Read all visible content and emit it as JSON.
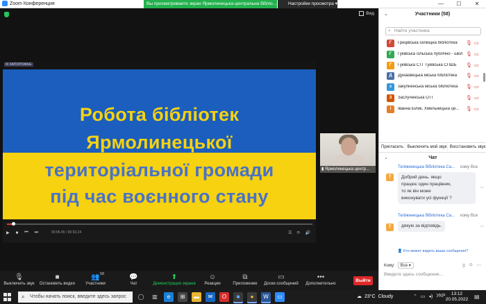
{
  "window": {
    "title": "Zoom Конференция",
    "minimize": "—",
    "maximize": "☐",
    "close": "✕"
  },
  "banner": {
    "text": "Вы просматриваете экран Ярмолинецька центральна бібліо...",
    "view_options": "Настройки просмотра"
  },
  "meeting": {
    "view_label": "Вид",
    "slide": {
      "top_strip": "III ЗАПОРОЖЬЕ",
      "lines": [
        "Робота бібліотек",
        "Ярмолинецької",
        "територіальної громади",
        "під час воєнного стану"
      ],
      "colors": {
        "blue": "#1b5ebe",
        "yellow": "#f6d210"
      }
    },
    "player": {
      "progress": 0.02,
      "time": "00:06.45 / 00:53.24"
    },
    "thumbnail_name": "Ярмолинецька центр..."
  },
  "toolbar": {
    "mute": "Выключить звук",
    "video": "Остановить видео",
    "participants": "Участники",
    "participants_count": "58",
    "chat": "Чат",
    "share": "Демонстрация экрана",
    "reactions": "Реакции",
    "apps": "Приложение",
    "whiteboard": "Доски сообщений",
    "more": "Дополнительно",
    "leave": "Выйти"
  },
  "participants_panel": {
    "title": "Участники (58)",
    "search_placeholder": "Найти участника",
    "items": [
      {
        "initial": "Г",
        "name": "Грицівська селищна бібліотека",
        "color": "#d04a3a"
      },
      {
        "initial": "Г",
        "name": "Гуківська сільська публічно - шкіл...",
        "color": "#34a853"
      },
      {
        "initial": "Г",
        "name": "Гуківська СТГ  Гуківська СПШБ",
        "color": "#f39c12"
      },
      {
        "initial": "Д",
        "name": "Дунаєвецька міська бібліотека",
        "color": "#4a6fa5"
      },
      {
        "initial": "з",
        "name": "закупненська міська бібліотека",
        "color": "#3498db"
      },
      {
        "initial": "З",
        "name": "Заслученська ОТГ",
        "color": "#d35400"
      },
      {
        "initial": "І",
        "name": "Іванна Білик, Хмельницька це...",
        "color": "#e67e22"
      }
    ],
    "buttons": [
      "Пригласить",
      "Выключить мой звук",
      "Восстановить звук"
    ]
  },
  "chat": {
    "title": "Чат",
    "messages": [
      {
        "from": "Теліжинецька бібліотека Са...",
        "to": "кому Все",
        "avatar": "Т",
        "text": [
          "Добрий день. якщо",
          "працює один працівник,",
          "то як він може",
          "виконувати усі функції ?"
        ]
      },
      {
        "from": "Теліжинецька бібліотека Са...",
        "to": "кому Все",
        "avatar": "Т",
        "text": [
          "дякую за відповідь."
        ]
      }
    ],
    "privacy_notice": "Кто может видеть ваши сообщения?",
    "to_label": "Кому:",
    "to_value": "Все",
    "input_placeholder": "Введите здесь сообщение..."
  },
  "taskbar": {
    "search_placeholder": "Чтобы начать поиск, введите здесь запрос",
    "weather_temp": "23°C",
    "weather_text": "Cloudy",
    "lang": "УКР",
    "time": "13:12",
    "date": "20.05.2022"
  }
}
